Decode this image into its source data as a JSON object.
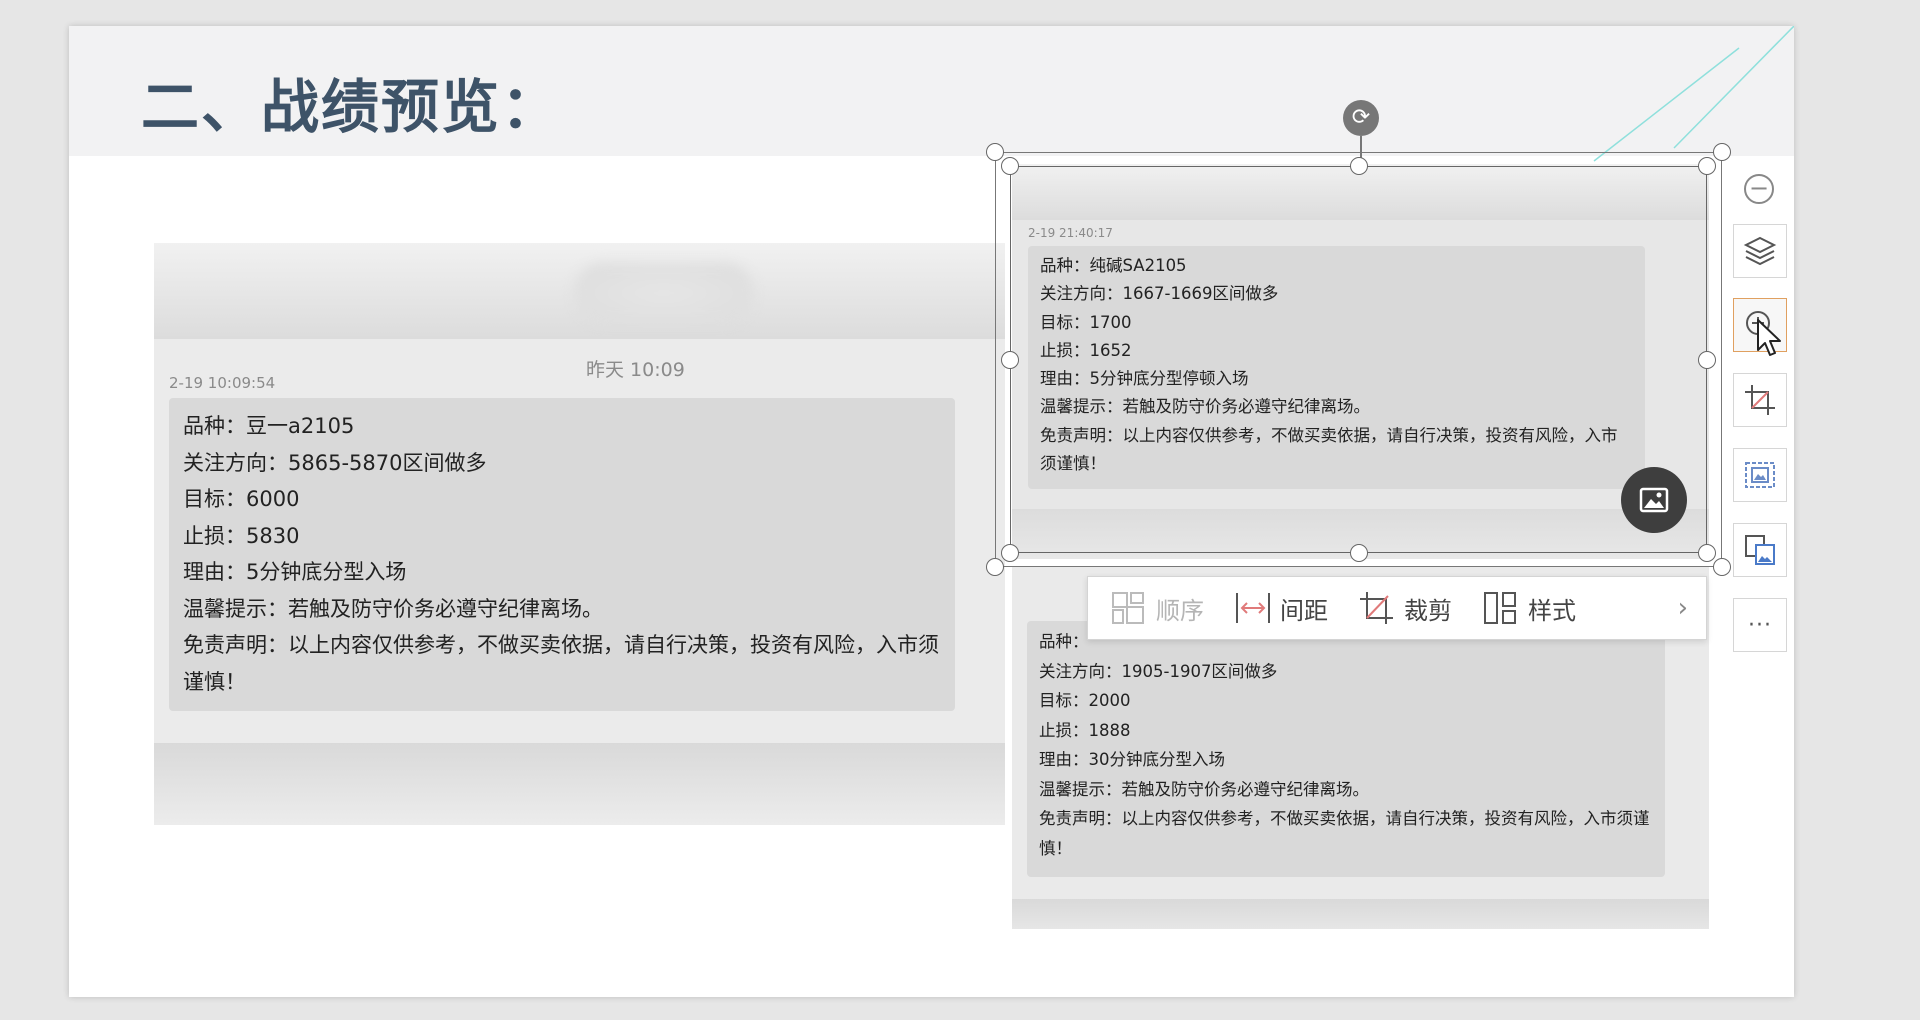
{
  "slide": {
    "title": "二、战绩预览："
  },
  "panel1": {
    "chat_time": "昨天 10:09",
    "timestamp": "2-19 10:09:54",
    "lines": [
      "品种：豆一a2105",
      "关注方向：5865-5870区间做多",
      "目标：6000",
      "止损：5830",
      "理由：5分钟底分型入场",
      "温馨提示：若触及防守价务必遵守纪律离场。"
    ],
    "disclaimer": "免责声明：以上内容仅供参考，不做买卖依据，请自行决策，投资有风险，入市须谨慎！"
  },
  "panel2": {
    "timestamp": "2-19 21:40:17",
    "lines": [
      "品种：纯碱SA2105",
      "关注方向：1667-1669区间做多",
      "目标：1700",
      "止损：1652",
      "理由：5分钟底分型停顿入场",
      "温馨提示：若触及防守价务必遵守纪律离场。"
    ],
    "disclaimer": "免责声明：以上内容仅供参考，不做买卖依据，请自行决策，投资有风险，入市须谨慎！"
  },
  "panel3": {
    "lines": [
      "品种：",
      "关注方向：1905-1907区间做多",
      "目标：2000",
      "止损：1888",
      "理由：30分钟底分型入场",
      "温馨提示：若触及防守价务必遵守纪律离场。"
    ],
    "disclaimer": "免责声明：以上内容仅供参考，不做买卖依据，请自行决策，投资有风险，入市须谨慎！"
  },
  "float_toolbar": {
    "order_label": "顺序",
    "spacing_label": "间距",
    "crop_label": "裁剪",
    "style_label": "样式",
    "more_glyph": "›"
  },
  "side_toolbar": {
    "minus_glyph": "−",
    "more_glyph": "···"
  },
  "icons": {
    "rotate": "rotate-icon",
    "image": "image-icon"
  },
  "colors": {
    "title": "#3e5368",
    "accent_line": "#7fd8d8",
    "active_border": "#e0a060"
  }
}
